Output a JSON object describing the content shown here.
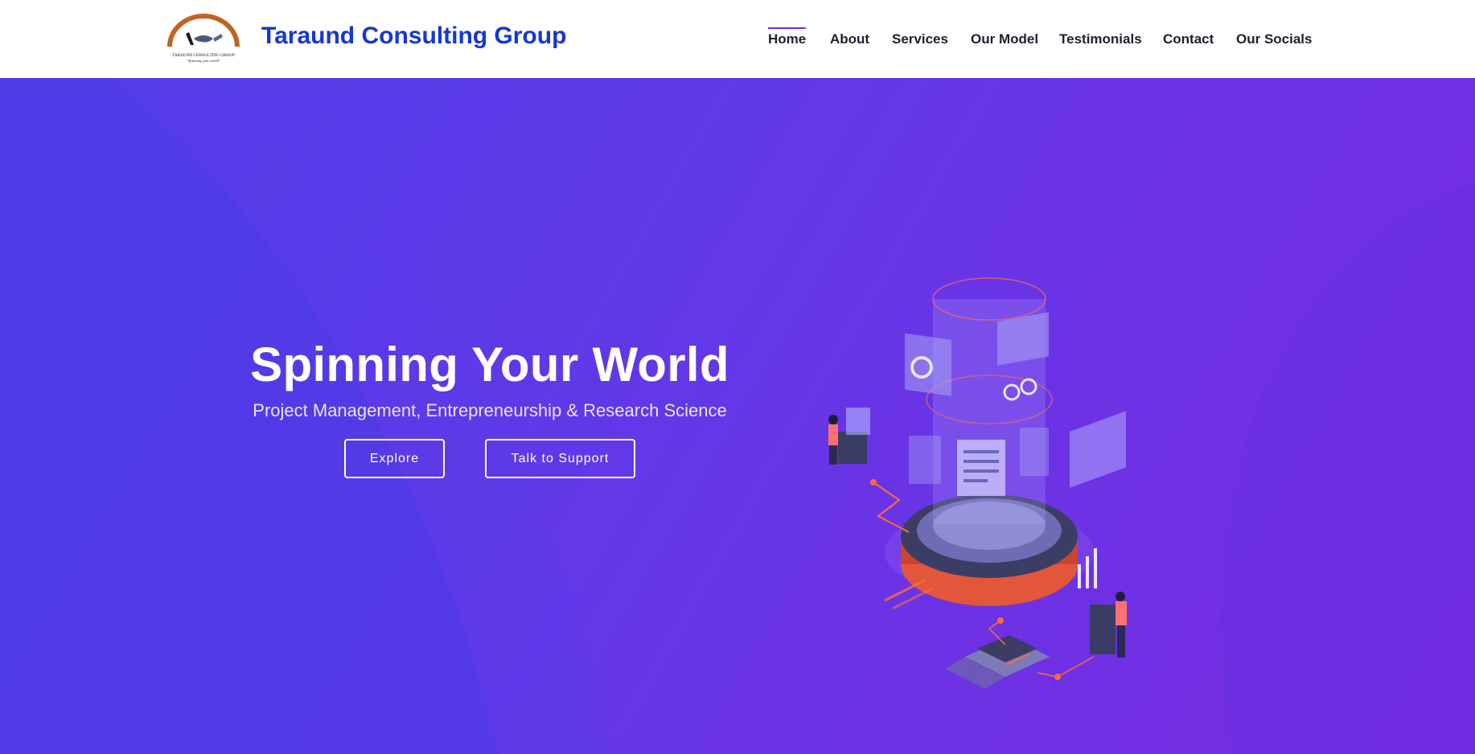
{
  "header": {
    "logo_alt": "Taraund Consulting Group logo",
    "logo_caption": "TARAUND CONSULTING GROUP",
    "logo_tagline": "\"Spinning your world\"",
    "brand": "Taraund Consulting Group",
    "nav": [
      {
        "label": "Home",
        "active": true
      },
      {
        "label": "About",
        "active": false
      },
      {
        "label": "Services",
        "active": false
      },
      {
        "label": "Our Model",
        "active": false
      },
      {
        "label": "Testimonials",
        "active": false
      },
      {
        "label": "Contact",
        "active": false
      },
      {
        "label": "Our Socials",
        "active": false
      }
    ]
  },
  "hero": {
    "title": "Spinning Your World",
    "subtitle": "Project Management, Entrepreneurship & Research Science",
    "explore_label": "Explore",
    "support_label": "Talk to Support"
  },
  "colors": {
    "brand_blue": "#1437d6",
    "hero_start": "#4f3ee8",
    "hero_end": "#7a2ae0",
    "nav_active_bar": "#6a2ee8",
    "accent_orange": "#f2613b"
  },
  "icons": {
    "logo": "handshake-arc-logo",
    "illustration": "isometric-data-tower-illustration"
  }
}
